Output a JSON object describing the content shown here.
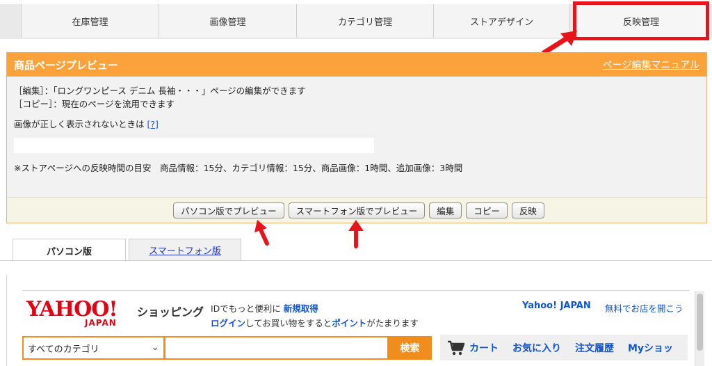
{
  "topnav": {
    "tabs": [
      {
        "label": "在庫管理"
      },
      {
        "label": "画像管理"
      },
      {
        "label": "カテゴリ管理"
      },
      {
        "label": "ストアデザイン"
      },
      {
        "label": "反映管理"
      }
    ]
  },
  "panel": {
    "title": "商品ページプレビュー",
    "manual_link": "ページ編集マニュアル",
    "line_edit": "［編集］：「ロングワンピース デニム 長袖・・・」ページの編集ができます",
    "line_copy": "［コピー］：現在のページを流用できます",
    "image_note": "画像が正しく表示されないときは",
    "help_link": "[?]",
    "time_note": "※ストアページへの反映時間の目安　商品情報：15分、カテゴリ情報：15分、商品画像：1時間、追加画像：3時間",
    "buttons": {
      "pc_preview": "パソコン版でプレビュー",
      "sp_preview": "スマートフォン版でプレビュー",
      "edit": "編集",
      "copy": "コピー",
      "publish": "反映"
    }
  },
  "view_tabs": {
    "pc": "パソコン版",
    "sp": "スマートフォン版"
  },
  "preview": {
    "logo_text": "YAHOO!",
    "logo_sub": "JAPAN",
    "shopping_label": "ショッピング",
    "promo1_pre": "IDでもっと便利に",
    "promo1_link": "新規取得",
    "promo2_link1": "ログイン",
    "promo2_mid": "してお買い物をすると",
    "promo2_link2": "ポイント",
    "promo2_post": "がたまります",
    "yahoo_japan": "Yahoo! JAPAN",
    "open_store": "無料でお店を開こう",
    "category_select": "すべてのカテゴリ",
    "search_button": "検索",
    "menu": {
      "cart": "カート",
      "favorites": "お気に入り",
      "orders": "注文履歴",
      "my": "Myショッ"
    }
  },
  "colors": {
    "accent_orange": "#fba33a",
    "search_orange": "#f08d1c",
    "annotation_red": "#e8141b",
    "link_blue": "#1155cc",
    "yahoo_red": "#e60012"
  }
}
